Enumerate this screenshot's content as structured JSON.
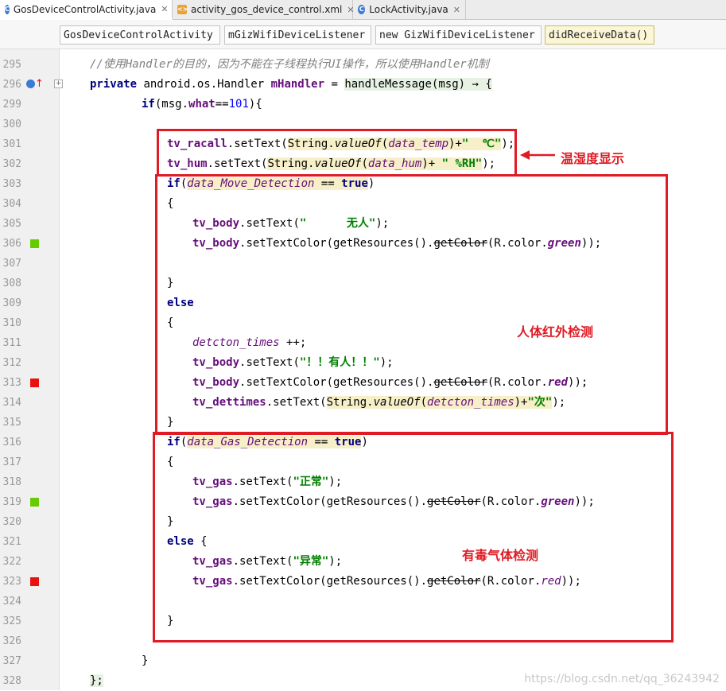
{
  "tabs": [
    {
      "label": "GosDeviceControlActivity.java",
      "icon": "java-class-icon",
      "active": true
    },
    {
      "label": "activity_gos_device_control.xml",
      "icon": "xml-file-icon",
      "active": false
    },
    {
      "label": "LockActivity.java",
      "icon": "java-class-icon",
      "active": false
    }
  ],
  "breadcrumbs": [
    "GosDeviceControlActivity",
    "mGizWifiDeviceListener",
    "new GizWifiDeviceListener",
    "didReceiveData()"
  ],
  "lines": [
    {
      "n": "295",
      "code": [
        [
          "cmt",
          "//使用Handler的目的，因为不能在子线程执行UI操作，所以使用Handler机制"
        ]
      ]
    },
    {
      "n": "296",
      "code": [
        [
          "kw",
          "private "
        ],
        [
          "",
          "android.os.Handler "
        ],
        [
          "fld",
          "mHandler"
        ],
        [
          "",
          " = "
        ],
        [
          "hl2",
          "handleMessage(msg) → {"
        ]
      ]
    },
    {
      "n": "299",
      "code": [
        [
          "kw",
          "if"
        ],
        [
          "",
          "(msg."
        ],
        [
          "fld",
          "what"
        ],
        [
          "",
          "=="
        ],
        [
          "num",
          "101"
        ],
        [
          "",
          "){"
        ]
      ]
    },
    {
      "n": "300",
      "code": []
    },
    {
      "n": "301",
      "code": [
        [
          "fld",
          "tv_racall"
        ],
        [
          "",
          ".setText("
        ],
        [
          "hl",
          "String."
        ],
        [
          "hl sm",
          "valueOf"
        ],
        [
          "hl",
          "("
        ],
        [
          "hl ifld",
          "data_temp"
        ],
        [
          "hl",
          ")+"
        ],
        [
          "hl str",
          "\"  ℃\""
        ],
        [
          "",
          ");"
        ]
      ]
    },
    {
      "n": "302",
      "code": [
        [
          "fld",
          "tv_hum"
        ],
        [
          "",
          ".setText("
        ],
        [
          "hl",
          "String."
        ],
        [
          "hl sm",
          "valueOf"
        ],
        [
          "hl",
          "("
        ],
        [
          "hl ifld",
          "data_hum"
        ],
        [
          "hl",
          ")+ "
        ],
        [
          "hl str",
          "\" %RH\""
        ],
        [
          "",
          ");"
        ]
      ]
    },
    {
      "n": "303",
      "code": [
        [
          "kw",
          "if"
        ],
        [
          "",
          "("
        ],
        [
          "hl ifld",
          "data_Move_Detection"
        ],
        [
          "hl",
          " == "
        ],
        [
          "hl kw",
          "true"
        ],
        [
          "",
          ")"
        ]
      ]
    },
    {
      "n": "304",
      "code": [
        [
          "",
          "{"
        ]
      ]
    },
    {
      "n": "305",
      "code": [
        [
          "fld",
          "tv_body"
        ],
        [
          "",
          ".setText("
        ],
        [
          "str",
          "\"      无人\""
        ],
        [
          "",
          ");"
        ]
      ]
    },
    {
      "n": "306",
      "code": [
        [
          "fld",
          "tv_body"
        ],
        [
          "",
          ".setTextColor(getResources()."
        ],
        [
          "strike",
          "getColor"
        ],
        [
          "",
          "(R.color."
        ],
        [
          "fld ifld",
          "green"
        ],
        [
          "",
          "));"
        ]
      ]
    },
    {
      "n": "307",
      "code": []
    },
    {
      "n": "308",
      "code": [
        [
          "",
          "}"
        ]
      ]
    },
    {
      "n": "309",
      "code": [
        [
          "kw",
          "else"
        ]
      ]
    },
    {
      "n": "310",
      "code": [
        [
          "",
          "{"
        ]
      ]
    },
    {
      "n": "311",
      "code": [
        [
          "ifld",
          "detcton_times"
        ],
        [
          "",
          " ++;"
        ]
      ]
    },
    {
      "n": "312",
      "code": [
        [
          "fld",
          "tv_body"
        ],
        [
          "",
          ".setText("
        ],
        [
          "str",
          "\"！！有人！！\""
        ],
        [
          "",
          ");"
        ]
      ]
    },
    {
      "n": "313",
      "code": [
        [
          "fld",
          "tv_body"
        ],
        [
          "",
          ".setTextColor(getResources()."
        ],
        [
          "strike",
          "getColor"
        ],
        [
          "",
          "(R.color."
        ],
        [
          "fld ifld",
          "red"
        ],
        [
          "",
          "));"
        ]
      ]
    },
    {
      "n": "314",
      "code": [
        [
          "fld",
          "tv_dettimes"
        ],
        [
          "",
          ".setText("
        ],
        [
          "hl",
          "String."
        ],
        [
          "hl sm",
          "valueOf"
        ],
        [
          "hl",
          "("
        ],
        [
          "hl ifld",
          "detcton_times"
        ],
        [
          "hl",
          ")+"
        ],
        [
          "hl str",
          "\"次\""
        ],
        [
          "",
          ");"
        ]
      ]
    },
    {
      "n": "315",
      "code": [
        [
          "",
          "}"
        ]
      ]
    },
    {
      "n": "316",
      "code": [
        [
          "kw",
          "if"
        ],
        [
          "",
          "("
        ],
        [
          "hl ifld",
          "data_Gas_Detection"
        ],
        [
          "hl",
          " == "
        ],
        [
          "hl kw",
          "true"
        ],
        [
          "",
          ")"
        ]
      ]
    },
    {
      "n": "317",
      "code": [
        [
          "",
          "{"
        ]
      ]
    },
    {
      "n": "318",
      "code": [
        [
          "fld",
          "tv_gas"
        ],
        [
          "",
          ".setText("
        ],
        [
          "str",
          "\"正常\""
        ],
        [
          "",
          ");"
        ]
      ]
    },
    {
      "n": "319",
      "code": [
        [
          "fld",
          "tv_gas"
        ],
        [
          "",
          ".setTextColor(getResources()."
        ],
        [
          "strike",
          "getColor"
        ],
        [
          "",
          "(R.color."
        ],
        [
          "fld ifld",
          "green"
        ],
        [
          "",
          "));"
        ]
      ]
    },
    {
      "n": "320",
      "code": [
        [
          "",
          "}"
        ]
      ]
    },
    {
      "n": "321",
      "code": [
        [
          "kw",
          "else"
        ],
        [
          "",
          " {"
        ]
      ]
    },
    {
      "n": "322",
      "code": [
        [
          "fld",
          "tv_gas"
        ],
        [
          "",
          ".setText("
        ],
        [
          "str",
          "\"异常\""
        ],
        [
          "",
          ");"
        ]
      ]
    },
    {
      "n": "323",
      "code": [
        [
          "fld",
          "tv_gas"
        ],
        [
          "",
          ".setTextColor(getResources()."
        ],
        [
          "strike",
          "getColor"
        ],
        [
          "",
          "(R.color."
        ],
        [
          "ifld",
          "red"
        ],
        [
          "",
          "));"
        ]
      ]
    },
    {
      "n": "324",
      "code": []
    },
    {
      "n": "325",
      "code": [
        [
          "",
          "}"
        ]
      ]
    },
    {
      "n": "326",
      "code": []
    },
    {
      "n": "327",
      "code": [
        [
          "",
          "}"
        ]
      ]
    },
    {
      "n": "328",
      "code": [
        [
          "hl2",
          "};"
        ]
      ]
    }
  ],
  "annotations": {
    "temp_hum": "温湿度显示",
    "body_detect": "人体红外检测",
    "gas_detect": "有毒气体检测"
  },
  "watermark": "https://blog.csdn.net/qq_36243942",
  "colors": {
    "annotation": "#e01b24",
    "green_marker": "#66cc00",
    "red_marker": "#e8110f"
  }
}
